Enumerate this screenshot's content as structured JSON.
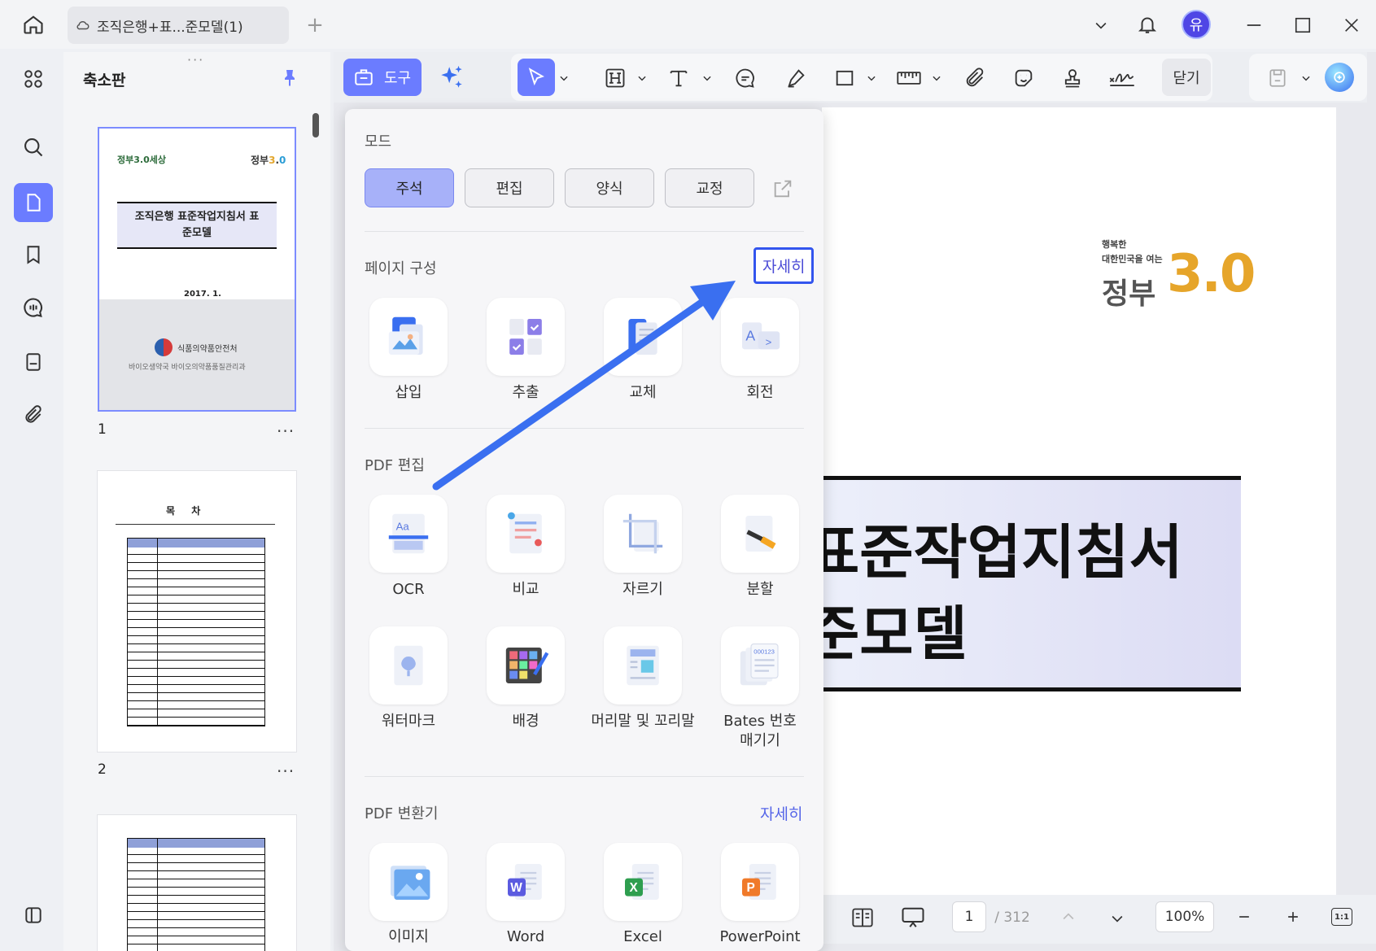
{
  "titlebar": {
    "doc_tab_title": "조직은행+표...준모델(1)",
    "user_initial": "유"
  },
  "thumbnails": {
    "title": "축소판",
    "pages": [
      {
        "number": "1",
        "more": "..."
      },
      {
        "number": "2",
        "more": "..."
      }
    ],
    "page1": {
      "logo_left": "정부3.0세상",
      "heading": "조직은행 표준작업지침서 표준모델",
      "date": "2017. 1.",
      "org_name": "식품의약품안전처",
      "org_sub": "바이오생약국 바이오의약품품질관리과"
    },
    "page2": {
      "heading": "목 차"
    }
  },
  "toolbar": {
    "tools_label": "도구",
    "close_label": "닫기"
  },
  "popup": {
    "mode_title": "모드",
    "modes": [
      "주석",
      "편집",
      "양식",
      "교정"
    ],
    "selected_mode": "주석",
    "page_section_title": "페이지 구성",
    "page_section_more": "자세히",
    "page_items": [
      "삽입",
      "추출",
      "교체",
      "회전"
    ],
    "edit_section_title": "PDF 편집",
    "edit_items": [
      "OCR",
      "비교",
      "자르기",
      "분할"
    ],
    "edit_items_2": [
      "워터마크",
      "배경",
      "머리말 및 꼬리말",
      "Bates 번호 매기기"
    ],
    "convert_section_title": "PDF 변환기",
    "convert_section_more": "자세히",
    "convert_items": [
      "이미지",
      "Word",
      "Excel",
      "PowerPoint"
    ]
  },
  "document": {
    "logo_line1": "행복한",
    "logo_line2": "대한민국을 여는",
    "logo_main": "정부",
    "logo_num": "3.0",
    "title_line1": "표준작업지침서",
    "title_line2": "준모델"
  },
  "bottombar": {
    "current_page": "1",
    "total_pages": "/ 312",
    "zoom": "100%"
  },
  "colors": {
    "accent": "#6b7cff",
    "arrow": "#3a6ff0",
    "highlight_border": "#3355ee"
  }
}
